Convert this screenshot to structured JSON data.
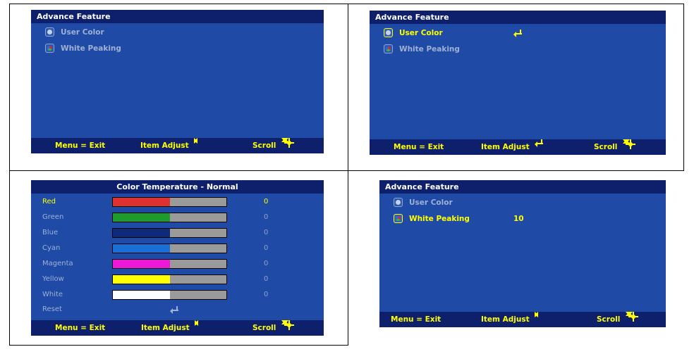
{
  "panels": {
    "p1": {
      "title": "Advance Feature",
      "items": [
        {
          "label": "User Color"
        },
        {
          "label": "White Peaking"
        }
      ],
      "footer": {
        "exit": "Menu = Exit",
        "adjust": "Item Adjust",
        "scroll": "Scroll"
      }
    },
    "p2": {
      "title": "Advance Feature",
      "items": [
        {
          "label": "User Color"
        },
        {
          "label": "White Peaking"
        }
      ],
      "footer": {
        "exit": "Menu = Exit",
        "adjust": "Item Adjust",
        "scroll": "Scroll"
      }
    },
    "p3": {
      "title": "Color Temperature - Normal",
      "rows": [
        {
          "label": "Red",
          "value": "0",
          "color": "#e03030",
          "level": 0.5
        },
        {
          "label": "Green",
          "value": "0",
          "color": "#1f9a2c",
          "level": 0.5
        },
        {
          "label": "Blue",
          "value": "0",
          "color": "#102a7a",
          "level": 0.5
        },
        {
          "label": "Cyan",
          "value": "0",
          "color": "#1a6fd6",
          "level": 0.5
        },
        {
          "label": "Magenta",
          "value": "0",
          "color": "#f018d8",
          "level": 0.5
        },
        {
          "label": "Yellow",
          "value": "0",
          "color": "#ffff00",
          "level": 0.5
        },
        {
          "label": "White",
          "value": "0",
          "color": "#ffffff",
          "level": 0.5
        }
      ],
      "reset_label": "Reset",
      "footer": {
        "exit": "Menu = Exit",
        "adjust": "Item Adjust",
        "scroll": "Scroll"
      }
    },
    "p4": {
      "title": "Advance Feature",
      "items": [
        {
          "label": "User Color"
        },
        {
          "label": "White Peaking",
          "value": "10"
        }
      ],
      "footer": {
        "exit": "Menu = Exit",
        "adjust": "Item Adjust",
        "scroll": "Scroll"
      }
    }
  },
  "colors": {
    "osd_bg": "#1f4aa6",
    "osd_bar": "#0e1f6b",
    "highlight": "#ffff00",
    "dim_text": "#9fb1d4"
  }
}
